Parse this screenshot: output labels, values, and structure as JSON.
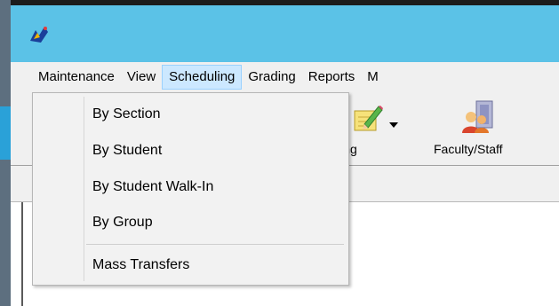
{
  "menubar": {
    "items": [
      {
        "label": "Maintenance"
      },
      {
        "label": "View"
      },
      {
        "label": "Scheduling",
        "active": true
      },
      {
        "label": "Grading"
      },
      {
        "label": "Reports"
      },
      {
        "label": "M"
      }
    ]
  },
  "toolbar": {
    "grading_label": "Grading",
    "faculty_label": "Faculty/Staff"
  },
  "dropdown": {
    "items": [
      {
        "label": "By Section"
      },
      {
        "label": "By Student"
      },
      {
        "label": "By Student Walk-In"
      },
      {
        "label": "By Group"
      },
      {
        "label": "Mass Transfers"
      }
    ]
  },
  "colors": {
    "titlebar": "#5bc2e7",
    "menu_highlight": "#cce8ff",
    "menu_highlight_border": "#99d1ff",
    "dropdown_bg": "#f2f2f2"
  },
  "icons": {
    "app": "app-icon",
    "grading": "pencil-paper-icon",
    "faculty": "faculty-staff-icon"
  }
}
